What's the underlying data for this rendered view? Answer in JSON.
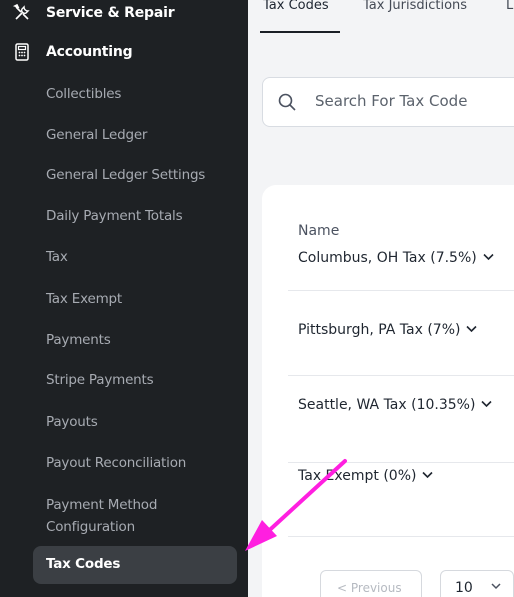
{
  "sidebar": {
    "sections": [
      {
        "label": "Service & Repair",
        "icon": "wrench-screwdriver-icon"
      },
      {
        "label": "Accounting",
        "icon": "calculator-icon"
      }
    ],
    "items": [
      "Collectibles",
      "General Ledger",
      "General Ledger Settings",
      "Daily Payment Totals",
      "Tax",
      "Tax Exempt",
      "Payments",
      "Stripe Payments",
      "Payouts",
      "Payout Reconciliation",
      "Payment Method Configuration"
    ],
    "active_item": "Tax Codes"
  },
  "tabs": [
    {
      "label": "Tax Codes",
      "active": true
    },
    {
      "label": "Tax Jurisdictions",
      "active": false
    },
    {
      "label": "L",
      "active": false
    }
  ],
  "search": {
    "placeholder": "Search For Tax Code"
  },
  "table": {
    "column_header": "Name",
    "rows": [
      "Columbus, OH Tax (7.5%)",
      "Pittsburgh, PA Tax (7%)",
      "Seattle, WA Tax (10.35%)",
      "Tax Exempt (0%)"
    ]
  },
  "pagination": {
    "previous_label": "< Previous",
    "page_size": "10"
  },
  "colors": {
    "sidebar_bg": "#1e2124",
    "active_bg": "#3b3f44",
    "annotation_arrow": "#ff1fe0"
  }
}
